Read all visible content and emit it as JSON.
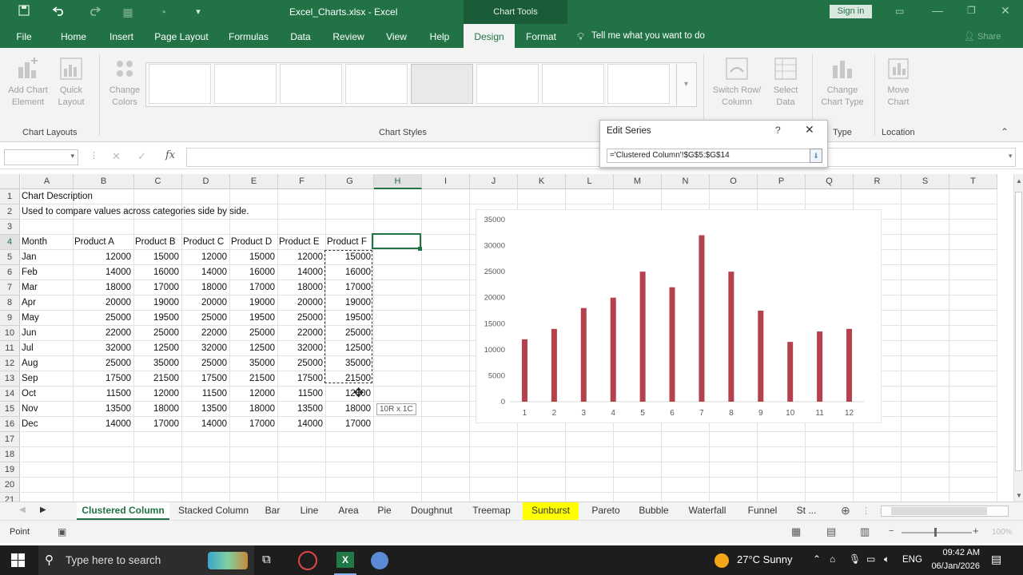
{
  "window": {
    "title": "Excel_Charts.xlsx  -  Excel",
    "context_title": "Chart Tools",
    "signin_label": "Sign in"
  },
  "tabs": [
    {
      "label": "File"
    },
    {
      "label": "Home"
    },
    {
      "label": "Insert"
    },
    {
      "label": "Page Layout"
    },
    {
      "label": "Formulas"
    },
    {
      "label": "Data"
    },
    {
      "label": "Review"
    },
    {
      "label": "View"
    },
    {
      "label": "Help"
    },
    {
      "label": "Design"
    },
    {
      "label": "Format"
    }
  ],
  "tell_me": "Tell me what you want to do",
  "share_label": "Share",
  "ribbon": {
    "add_chart_element": "Add Chart\nElement",
    "quick_layout": "Quick\nLayout",
    "change_colors": "Change\nColors",
    "switch_row_col": "Switch Row/\nColumn",
    "select_data": "Select\nData",
    "change_chart_type": "Change\nChart Type",
    "move_chart": "Move\nChart",
    "groups": {
      "layouts": "Chart Layouts",
      "styles": "Chart Styles",
      "type": "Type",
      "location": "Location"
    }
  },
  "formula_bar": {
    "fx": "fx",
    "value": ""
  },
  "dialog": {
    "title": "Edit Series",
    "help": "?",
    "reference": "='Clustered Column'!$G$5:$G$14"
  },
  "columns": [
    "A",
    "B",
    "C",
    "D",
    "E",
    "F",
    "G",
    "H",
    "I",
    "J",
    "K",
    "L",
    "M",
    "N",
    "O",
    "P",
    "Q",
    "R",
    "S",
    "T"
  ],
  "rows": [
    "1",
    "2",
    "3",
    "4",
    "5",
    "6",
    "7",
    "8",
    "9",
    "10",
    "11",
    "12",
    "13",
    "14",
    "15",
    "16",
    "17",
    "18",
    "19",
    "20",
    "21"
  ],
  "sheet": {
    "a1": "Chart Description",
    "a2": "Used to compare values across categories side by side.",
    "headers": [
      "Month",
      "Product A",
      "Product B",
      "Product C",
      "Product D",
      "Product E",
      "Product F"
    ],
    "data": [
      [
        "Jan",
        "12000",
        "15000",
        "12000",
        "15000",
        "12000",
        "15000"
      ],
      [
        "Feb",
        "14000",
        "16000",
        "14000",
        "16000",
        "14000",
        "16000"
      ],
      [
        "Mar",
        "18000",
        "17000",
        "18000",
        "17000",
        "18000",
        "17000"
      ],
      [
        "Apr",
        "20000",
        "19000",
        "20000",
        "19000",
        "20000",
        "19000"
      ],
      [
        "May",
        "25000",
        "19500",
        "25000",
        "19500",
        "25000",
        "19500"
      ],
      [
        "Jun",
        "22000",
        "25000",
        "22000",
        "25000",
        "22000",
        "25000"
      ],
      [
        "Jul",
        "32000",
        "12500",
        "32000",
        "12500",
        "32000",
        "12500"
      ],
      [
        "Aug",
        "25000",
        "35000",
        "25000",
        "35000",
        "25000",
        "35000"
      ],
      [
        "Sep",
        "17500",
        "21500",
        "17500",
        "21500",
        "17500",
        "21500"
      ],
      [
        "Oct",
        "11500",
        "12000",
        "11500",
        "12000",
        "11500",
        "12000"
      ],
      [
        "Nov",
        "13500",
        "18000",
        "13500",
        "18000",
        "13500",
        "18000"
      ],
      [
        "Dec",
        "14000",
        "17000",
        "14000",
        "17000",
        "14000",
        "17000"
      ]
    ],
    "selection_tip": "10R x 1C"
  },
  "chart_data": {
    "type": "bar",
    "categories": [
      "1",
      "2",
      "3",
      "4",
      "5",
      "6",
      "7",
      "8",
      "9",
      "10",
      "11",
      "12"
    ],
    "series": [
      {
        "values": [
          12000,
          14000,
          18000,
          20000,
          25000,
          22000,
          32000,
          25000,
          17500,
          11500,
          13500,
          14000
        ]
      }
    ],
    "ylim": [
      0,
      35000
    ],
    "yticks": [
      "0",
      "5000",
      "10000",
      "15000",
      "20000",
      "25000",
      "30000",
      "35000"
    ],
    "bar_color": "#b5414c",
    "grid": false
  },
  "sheet_tabs": [
    {
      "label": "Clustered Column",
      "active": true,
      "highlight": false
    },
    {
      "label": "Stacked Column",
      "active": false,
      "highlight": false
    },
    {
      "label": "Bar",
      "active": false,
      "highlight": false
    },
    {
      "label": "Line",
      "active": false,
      "highlight": false
    },
    {
      "label": "Area",
      "active": false,
      "highlight": false
    },
    {
      "label": "Pie",
      "active": false,
      "highlight": false
    },
    {
      "label": "Doughnut",
      "active": false,
      "highlight": false
    },
    {
      "label": "Treemap",
      "active": false,
      "highlight": false
    },
    {
      "label": "Sunburst",
      "active": false,
      "highlight": true
    },
    {
      "label": "Pareto",
      "active": false,
      "highlight": false
    },
    {
      "label": "Bubble",
      "active": false,
      "highlight": false
    },
    {
      "label": "Waterfall",
      "active": false,
      "highlight": false
    },
    {
      "label": "Funnel",
      "active": false,
      "highlight": false
    },
    {
      "label": "St ...",
      "active": false,
      "highlight": false
    }
  ],
  "status": {
    "mode": "Point",
    "zoom": "100%"
  },
  "taskbar": {
    "search_placeholder": "Type here to search",
    "weather": "27°C  Sunny",
    "lang": "ENG",
    "time": "09:42 AM",
    "date": "06/Jan/2026"
  },
  "colors": {
    "accent": "#217346",
    "bar": "#b5414c",
    "highlight": "#ffff00"
  }
}
